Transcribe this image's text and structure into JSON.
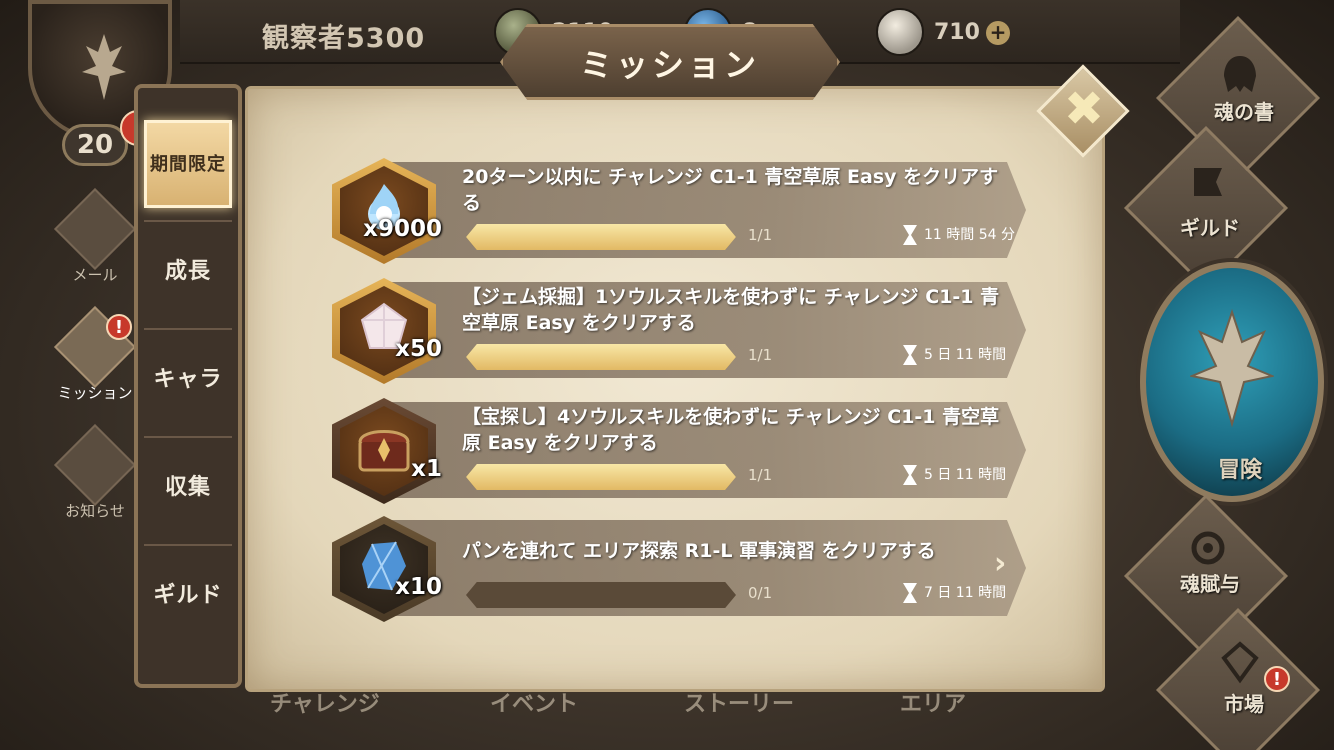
{
  "header": {
    "player_name": "観察者5300",
    "currencies": [
      {
        "icon": "coin-icon",
        "value": "2110"
      },
      {
        "icon": "blue-crystal-icon",
        "value": "8"
      },
      {
        "icon": "gem-icon",
        "value": "710"
      }
    ],
    "add_label": "+"
  },
  "profile": {
    "level": "20",
    "alert": "!"
  },
  "sidebar": {
    "items": [
      {
        "label": "メール",
        "icon": "mail-icon"
      },
      {
        "label": "ミッション",
        "icon": "mission-icon",
        "alert": "!"
      },
      {
        "label": "お知らせ",
        "icon": "notice-icon"
      }
    ]
  },
  "categories": {
    "tabs": [
      {
        "label": "期間限定",
        "active": true
      },
      {
        "label": "成長"
      },
      {
        "label": "キャラ"
      },
      {
        "label": "収集"
      },
      {
        "label": "ギルド"
      }
    ]
  },
  "dialog": {
    "title": "ミッション",
    "close_label": "✖"
  },
  "missions": [
    {
      "description": "20ターン以内に チャレンジ C1-1 青空草原 Easy をクリアする",
      "reward_icon": "soul-flame-icon",
      "quantity": "x9000",
      "progress_text": "1/1",
      "progress": 1.0,
      "time_left": "11 時間 54 分"
    },
    {
      "description": "【ジェム採掘】1ソウルスキルを使わずに チャレンジ C1-1 青空草原 Easy をクリアする",
      "reward_icon": "gem-icon",
      "quantity": "x50",
      "progress_text": "1/1",
      "progress": 1.0,
      "time_left": "5 日 11 時間"
    },
    {
      "description": "【宝探し】4ソウルスキルを使わずに チャレンジ C1-1 青空草原 Easy をクリアする",
      "reward_icon": "treasure-chest-icon",
      "quantity": "x1",
      "progress_text": "1/1",
      "progress": 1.0,
      "time_left": "5 日 11 時間"
    },
    {
      "description": "パンを連れて エリア探索 R1-L 軍事演習 をクリアする",
      "reward_icon": "blue-crystal-icon",
      "quantity": "x10",
      "progress_text": "0/1",
      "progress": 0.0,
      "time_left": "7 日 11 時間"
    }
  ],
  "right_nav": {
    "items": [
      {
        "label": "魂の書",
        "icon": "helmet-icon"
      },
      {
        "label": "ギルド",
        "icon": "guild-banner-icon"
      },
      {
        "label": "冒険",
        "icon": "adventure-emblem-icon"
      },
      {
        "label": "魂賦与",
        "icon": "soul-swirl-icon"
      },
      {
        "label": "市場",
        "icon": "market-icon",
        "alert": "!"
      }
    ]
  },
  "bottom_tabs": [
    "チャレンジ",
    "イベント",
    "ストーリー",
    "エリア"
  ],
  "colors": {
    "parchment": "#e9dec6",
    "gold_fill": "#e2b964",
    "alert_red": "#c7392b",
    "adventure_blue": "#1b6c84"
  }
}
